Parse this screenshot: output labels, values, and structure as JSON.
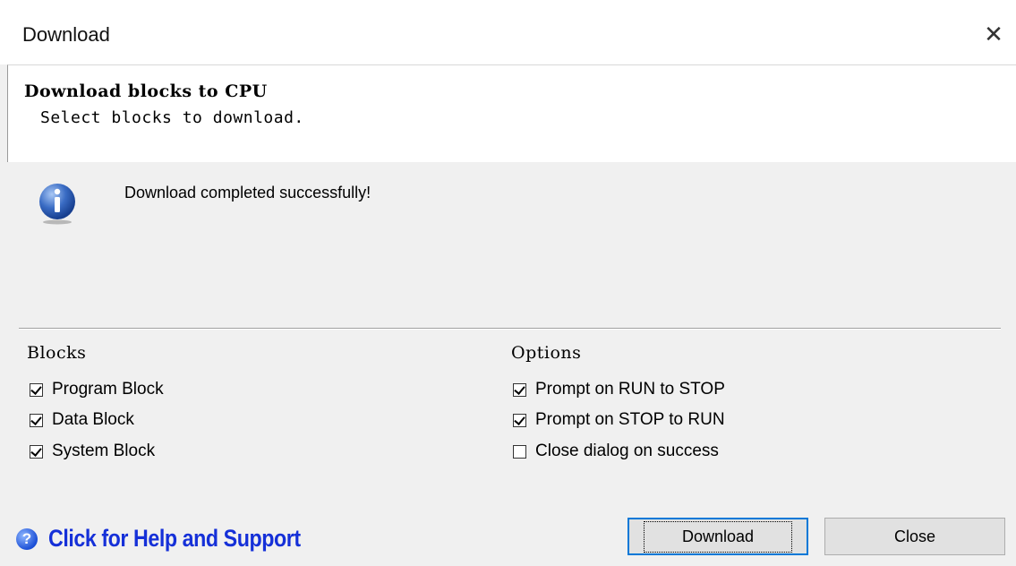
{
  "window": {
    "title": "Download",
    "close_glyph": "✕"
  },
  "header": {
    "title": "Download blocks to CPU",
    "subtitle": "Select blocks to download."
  },
  "status": {
    "icon": "info-icon",
    "message": "Download completed successfully!"
  },
  "blocks": {
    "title": "Blocks",
    "items": [
      {
        "label": "Program Block",
        "checked": true
      },
      {
        "label": "Data Block",
        "checked": true
      },
      {
        "label": "System Block",
        "checked": true
      }
    ]
  },
  "options": {
    "title": "Options",
    "items": [
      {
        "label": "Prompt on RUN to STOP",
        "checked": true
      },
      {
        "label": "Prompt on STOP to RUN",
        "checked": true
      },
      {
        "label": "Close dialog on success",
        "checked": false
      }
    ]
  },
  "help": {
    "icon": "help-icon",
    "label": "Click for Help and Support",
    "glyph": "?"
  },
  "buttons": {
    "download": "Download",
    "close": "Close"
  },
  "colors": {
    "help_link": "#1530d8",
    "focus_border": "#0078d7",
    "info_icon": "#2f5fb8"
  }
}
